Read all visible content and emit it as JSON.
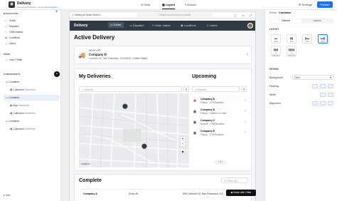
{
  "topbar": {
    "app_title": "Delivery",
    "app_subtitle": "Shopping Production on prospect",
    "app_subtitle_link": "Academy",
    "nav": [
      {
        "label": "Data",
        "icon": "database-icon"
      },
      {
        "label": "Layout",
        "icon": "layout-icon",
        "active": true
      },
      {
        "label": "Actions",
        "icon": "lightning-icon"
      }
    ],
    "settings_label": "Settings",
    "publish_label": "Publish"
  },
  "left_panel": {
    "navigation_header": "NAVIGATION",
    "nav_items": [
      "Driver",
      "Dispatch",
      "Order status",
      "Locations",
      "Users"
    ],
    "menu_header": "MENU",
    "menu_items": [
      "User Profile"
    ],
    "components_header": "COMPONENTS",
    "tree": [
      {
        "label": "Container",
        "tag": "",
        "indent": 0
      },
      {
        "label": "Collection",
        "tag": "Deliveries",
        "indent": 1
      },
      {
        "label": "Container",
        "tag": "",
        "indent": 0,
        "selected": true
      },
      {
        "label": "Map",
        "tag": "Deliveries",
        "indent": 1
      },
      {
        "label": "Collection",
        "tag": "Deliveries",
        "indent": 1
      },
      {
        "label": "Container",
        "tag": "",
        "indent": 0
      },
      {
        "label": "Collection",
        "tag": "Deliveries",
        "indent": 1
      }
    ],
    "footer_label": "Intro"
  },
  "canvas": {
    "viewing_as": "Viewing as Sarah Simon",
    "url_placeholder": "Publish to preview your website",
    "app": {
      "brand": "Delivery",
      "nav": [
        {
          "label": "Driver",
          "icon": "car-icon",
          "active": true
        },
        {
          "label": "Dispatch",
          "icon": "truck-icon"
        },
        {
          "label": "Order status",
          "icon": "list-icon"
        },
        {
          "label": "Locations",
          "icon": "pin-icon"
        },
        {
          "label": "Users",
          "icon": "user-icon"
        }
      ],
      "active_delivery_title": "Active Delivery",
      "active_delivery": {
        "status": "DROP-OFF",
        "company": "Company D",
        "address": "Lovers's Ln, San Francisco, CA 94131, United States"
      },
      "my_deliveries_title": "My Deliveries",
      "upcoming_title": "Upcoming",
      "search_placeholder": "Search",
      "map_attribution": "mapbox",
      "upcoming": [
        {
          "name": "Company B",
          "sub": "Pickup · 1709 Broderic...",
          "icon": "cancel-icon",
          "icon_color": "#d93025"
        },
        {
          "name": "Company B",
          "sub": "Pickup · Lovers's Ln, San...",
          "icon": "box-icon",
          "icon_color": "#555555"
        },
        {
          "name": "Company D",
          "sub": "Dropoff · 1709 Broderic...",
          "icon": "box-icon",
          "icon_color": "#555555"
        },
        {
          "name": "Company B",
          "sub": "Pickup · 1709 Broderic...",
          "icon": "box-icon",
          "icon_color": "#555555"
        }
      ],
      "pagination": "1",
      "complete_title": "Complete",
      "filter_placeholder": "Filter by...",
      "complete_rows": [
        {
          "company": "Company A",
          "type": "Drop-off",
          "address": "506 Clement St, San Francisco, CA..."
        }
      ]
    },
    "made_with": "Made with Glide"
  },
  "right_panel": {
    "tabs": [
      "Driver",
      "Container"
    ],
    "subtabs": [
      "General",
      "Options"
    ],
    "layout_header": "LAYOUT",
    "layout_options": [
      {
        "label": "Full",
        "selected": false
      },
      {
        "label": "1:1",
        "selected": false
      },
      {
        "label": "1:2",
        "selected": false
      },
      {
        "label": "2:1",
        "selected": true
      },
      {
        "label": "3 columns",
        "selected": false
      },
      {
        "label": "4 columns",
        "selected": false
      }
    ],
    "design_header": "DESIGN",
    "background_label": "Background",
    "background_value": "Card",
    "padding_label": "Padding",
    "width_label": "Width",
    "alignment_label": "Alignment"
  },
  "colors": {
    "accent": "#1f6feb",
    "app_nav": "#2f3a45",
    "selected": "#e8eefc"
  }
}
